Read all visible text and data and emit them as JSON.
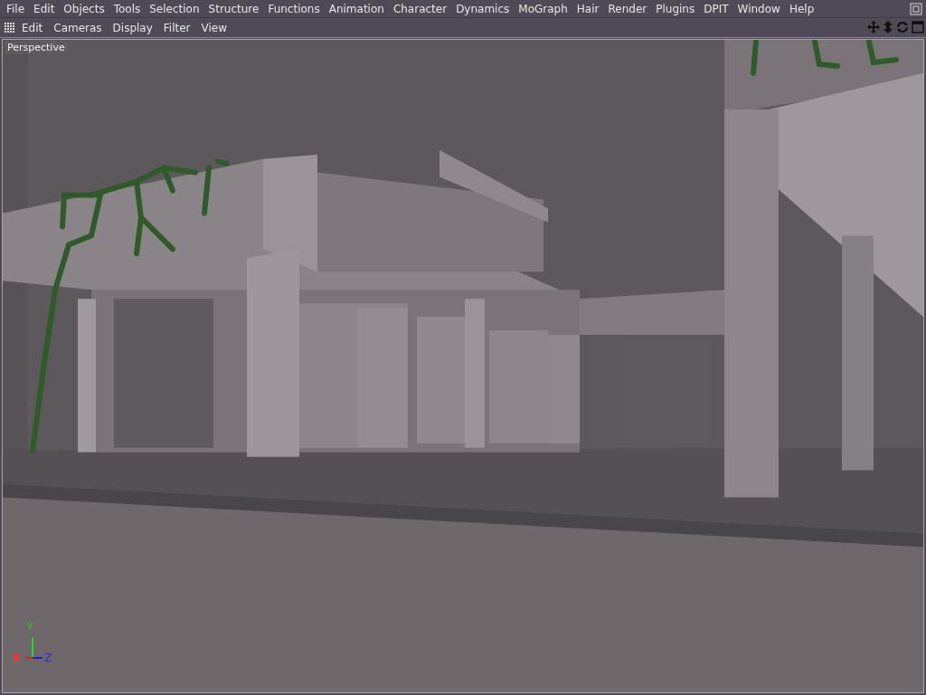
{
  "menu_bar": [
    "File",
    "Edit",
    "Objects",
    "Tools",
    "Selection",
    "Structure",
    "Functions",
    "Animation",
    "Character",
    "Dynamics",
    "MoGraph",
    "Hair",
    "Render",
    "Plugins",
    "DPIT",
    "Window",
    "Help"
  ],
  "viewport_menu": [
    "Edit",
    "Cameras",
    "Display",
    "Filter",
    "View"
  ],
  "viewport": {
    "camera_label": "Perspective",
    "axis_labels": {
      "x": "X",
      "y": "Y",
      "z": "Z"
    }
  }
}
